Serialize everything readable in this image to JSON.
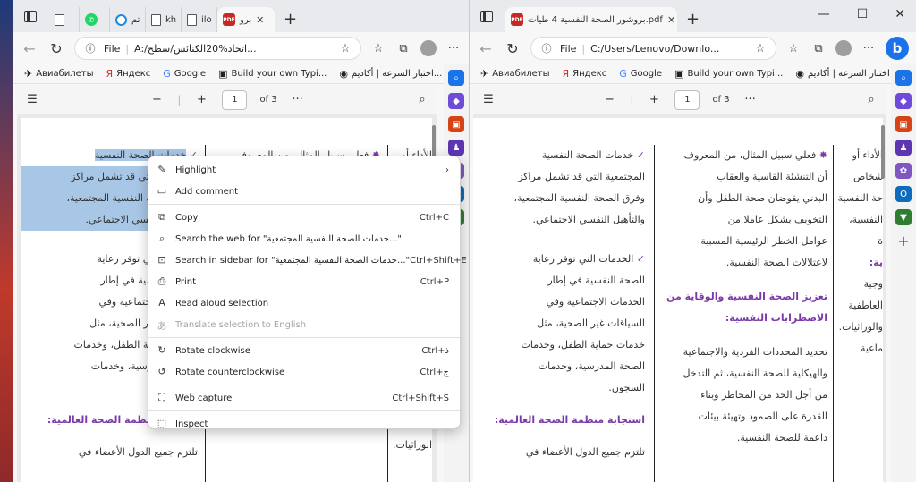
{
  "left_window": {
    "tabs": [
      {
        "label": "",
        "icon": "document-icon"
      },
      {
        "label": "",
        "icon": "whatsapp-icon"
      },
      {
        "label": "تم",
        "icon": "ring-icon"
      },
      {
        "label": "kh",
        "icon": "document-icon"
      },
      {
        "label": "ilo",
        "icon": "document-icon"
      },
      {
        "label": "برو",
        "icon": "pdf-icon",
        "active": true
      }
    ],
    "address": {
      "prefix": "File",
      "url": "A:/اتحاد%20الكنائس/سطح..."
    },
    "page_num": "1",
    "page_of": "of 3"
  },
  "right_window": {
    "tabs": [
      {
        "label": "بروشور الصحة النفسية 4 طيات.pdf",
        "icon": "pdf-icon",
        "active": true
      }
    ],
    "address": {
      "prefix": "File",
      "url": "C:/Users/Lenovo/Downlo..."
    },
    "page_num": "1",
    "page_of": "of 3"
  },
  "favorites": [
    {
      "label": "Авиабилеты",
      "icon": "plane-icon"
    },
    {
      "label": "Яндекс",
      "icon": "yandex-icon"
    },
    {
      "label": "Google",
      "icon": "google-icon"
    },
    {
      "label": "Build your own Typi...",
      "icon": "typing-icon"
    },
    {
      "label": "اختبار السرعة | أكاديم...",
      "icon": "speed-icon"
    }
  ],
  "context_menu": {
    "items": [
      {
        "label": "Highlight",
        "icon": "highlight-icon",
        "submenu": true
      },
      {
        "label": "Add comment",
        "icon": "comment-icon"
      },
      {
        "divider": true
      },
      {
        "label": "Copy",
        "icon": "copy-icon",
        "shortcut": "Ctrl+C"
      },
      {
        "label": "Search the web for \"خدمات الصحة النفسية المجتمعية...\"",
        "icon": "search-icon"
      },
      {
        "label": "Search in sidebar for \"خدمات الصحة النفسية المجتمعية...\"",
        "icon": "sidebar-search-icon",
        "shortcut": "Ctrl+Shift+E"
      },
      {
        "label": "Print",
        "icon": "print-icon",
        "shortcut": "Ctrl+P"
      },
      {
        "label": "Read aloud selection",
        "icon": "read-aloud-icon"
      },
      {
        "label": "Translate selection to English",
        "icon": "translate-icon",
        "disabled": true
      },
      {
        "divider": true
      },
      {
        "label": "Rotate clockwise",
        "icon": "rotate-cw-icon",
        "shortcut": "Ctrl+ذ"
      },
      {
        "label": "Rotate counterclockwise",
        "icon": "rotate-ccw-icon",
        "shortcut": "Ctrl+ج"
      },
      {
        "divider": true
      },
      {
        "label": "Web capture",
        "icon": "web-capture-icon",
        "shortcut": "Ctrl+Shift+S"
      },
      {
        "divider": true
      },
      {
        "label": "Inspect",
        "icon": "inspect-icon"
      }
    ]
  },
  "doc": {
    "col_mid": {
      "b1": [
        "خدمات الصحة النفسية",
        "المجتمعية التي قد تشمل مراكز",
        "وفرق الصحة النفسية المجتمعية،",
        "والتأهيل النفسي الاجتماعي."
      ],
      "b2": [
        "الخدمات التي توفر رعاية",
        "الصحة النفسية في إطار",
        "الخدمات الاجتماعية وفي",
        "السياقات غير الصحية، مثل",
        "خدمات حماية الطفل، وخدمات",
        "الصحة المدرسية، وخدمات",
        "السجون."
      ],
      "heading": "استجابة منظمة الصحة العالمية:",
      "tail": [
        "تلتزم جميع الدول الأعضاء في"
      ]
    },
    "col_right": {
      "intro": [
        "فعلي سبيل المثال، من المعروف",
        "أن التنشئة القاسية والعقاب",
        "البدني يقوضان صحة الطفل وأن",
        "التخويف يشكل عاملا من",
        "عوامل الخطر الرئيسية المسببة",
        "لاعتلالات الصحة النفسية."
      ],
      "heading": [
        "تعزيز الصحة النفسية والوقاية من",
        "الاضطرابات النفسية:"
      ],
      "body": [
        "تحديد المحددات الفردية والاجتماعية",
        "والهيكلية للصحة النفسية، ثم التدخل",
        "من أجل الحد من المخاطر وبناء",
        "القدرة على الصمود وتهيئة بيئات",
        "داعمة للصحة النفسية."
      ]
    },
    "col_edge": [
      "الأداء أو",
      "",
      "شخاص",
      "حة النفسية",
      "النفسية،",
      "ة",
      "",
      "ية:",
      "",
      "وجية",
      "العاطفية",
      "والوراثيات.",
      "",
      "ماعية"
    ]
  }
}
